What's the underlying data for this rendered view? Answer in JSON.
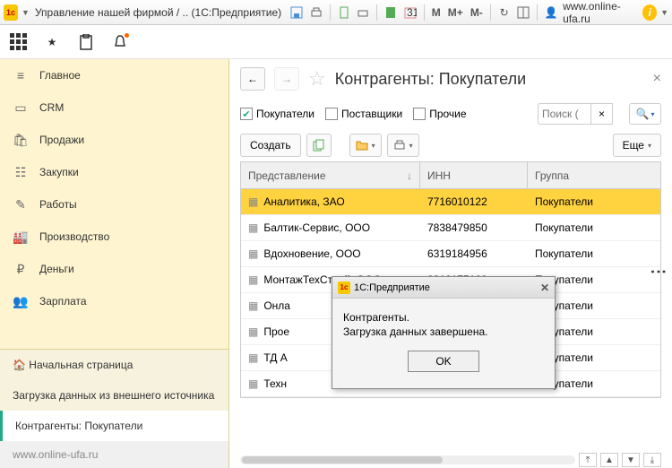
{
  "titlebar": {
    "title": "Управление нашей фирмой / .. (1С:Предприятие)",
    "m1": "M",
    "m2": "M+",
    "m3": "M-",
    "url": "www.online-ufa.ru"
  },
  "sidebar": {
    "items": [
      {
        "icon": "≡",
        "label": "Главное"
      },
      {
        "icon": "▭",
        "label": "CRM"
      },
      {
        "icon": "🛍",
        "label": "Продажи"
      },
      {
        "icon": "☷",
        "label": "Закупки"
      },
      {
        "icon": "✎",
        "label": "Работы"
      },
      {
        "icon": "🏭",
        "label": "Производство"
      },
      {
        "icon": "₽",
        "label": "Деньги"
      },
      {
        "icon": "👥",
        "label": "Зарплата"
      }
    ],
    "bottom": [
      {
        "label": "Начальная страница",
        "home": true
      },
      {
        "label": "Загрузка данных из внешнего источника"
      },
      {
        "label": "Контрагенты: Покупатели",
        "active": true
      }
    ],
    "footer": "www.online-ufa.ru"
  },
  "main": {
    "title": "Контрагенты: Покупатели",
    "filters": [
      {
        "label": "Покупатели",
        "checked": true
      },
      {
        "label": "Поставщики",
        "checked": false
      },
      {
        "label": "Прочие",
        "checked": false
      }
    ],
    "search_placeholder": "Поиск (",
    "toolbar": {
      "create": "Создать",
      "more": "Еще"
    },
    "columns": {
      "c1": "Представление",
      "c2": "ИНН",
      "c3": "Группа"
    },
    "rows": [
      {
        "name": "Аналитика, ЗАО",
        "inn": "7716010122",
        "group": "Покупатели",
        "sel": true
      },
      {
        "name": "Балтик-Сервис, ООО",
        "inn": "7838479850",
        "group": "Покупатели"
      },
      {
        "name": "Вдохновение, ООО",
        "inn": "6319184956",
        "group": "Покупатели"
      },
      {
        "name": "МонтажТехСтрой, ООО",
        "inn": "2312175169",
        "group": "Покупатели"
      },
      {
        "name": "Онла",
        "inn": "",
        "group": "Покупатели"
      },
      {
        "name": "Прое",
        "inn": "",
        "group": "Покупатели"
      },
      {
        "name": "ТД А",
        "inn": "",
        "group": "Покупатели"
      },
      {
        "name": "Техн",
        "inn": "",
        "group": "Покупатели"
      }
    ]
  },
  "modal": {
    "title": "1С:Предприятие",
    "line1": "Контрагенты.",
    "line2": "Загрузка данных завершена.",
    "ok": "OK"
  }
}
